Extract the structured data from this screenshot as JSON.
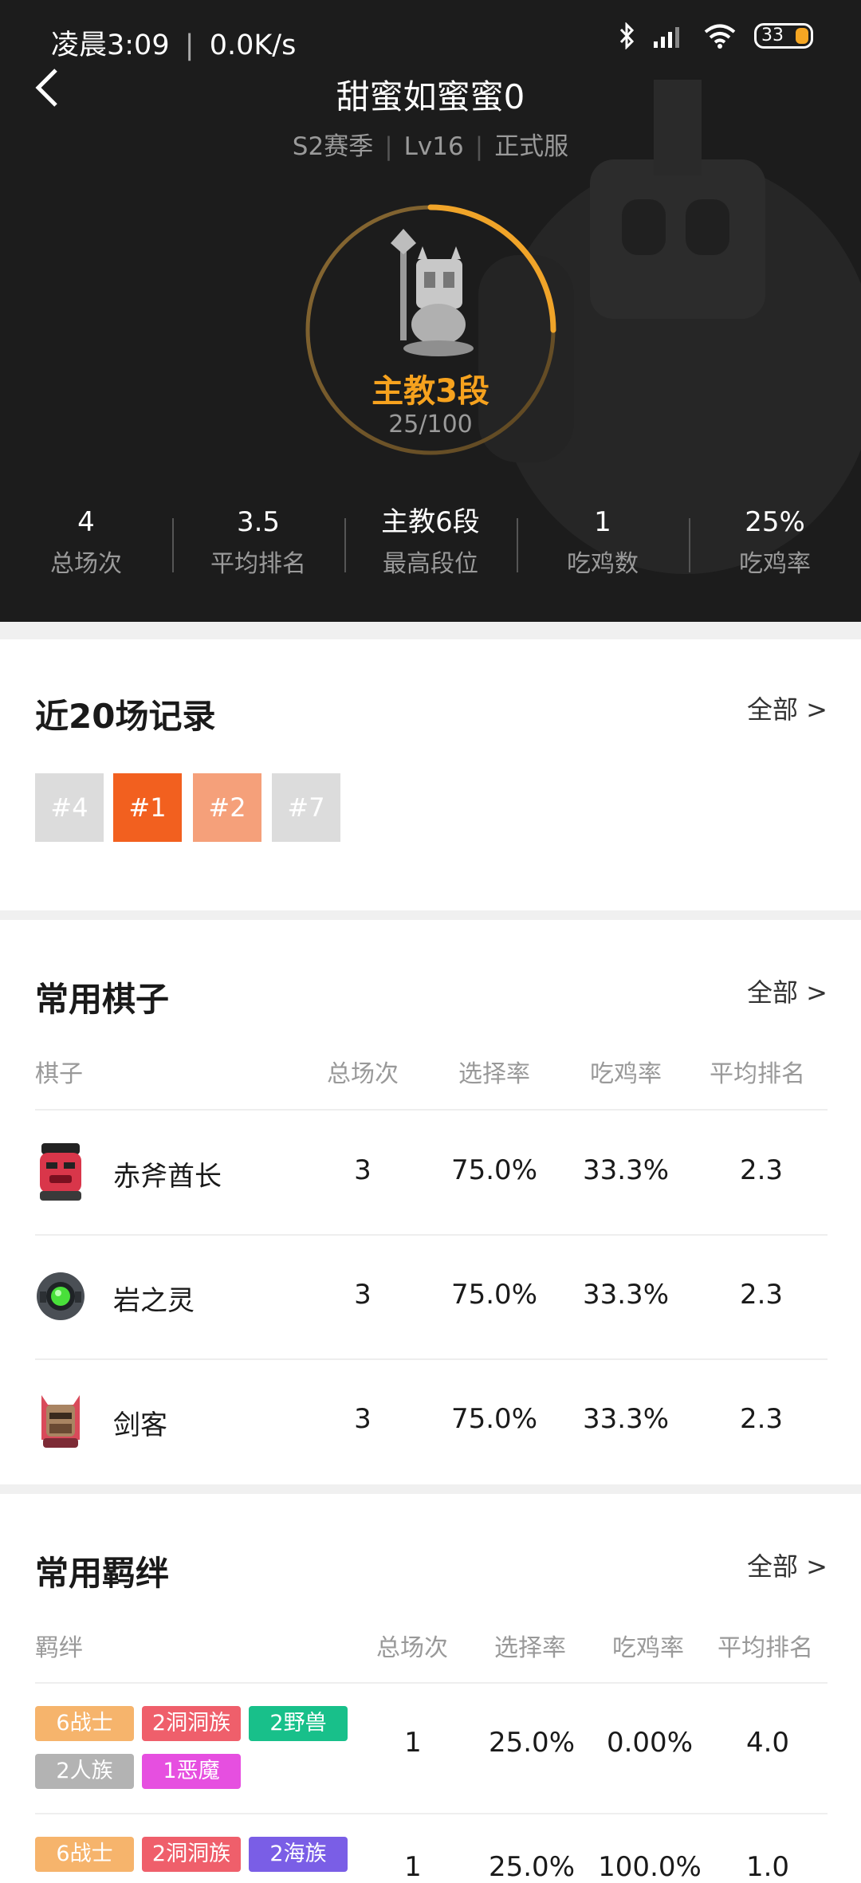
{
  "status_bar": {
    "time": "凌晨3:09",
    "speed": "0.0K/s",
    "battery": "33"
  },
  "header": {
    "title": "甜蜜如蜜蜜0",
    "season": "S2赛季",
    "level": "Lv16",
    "server": "正式服"
  },
  "rank": {
    "name": "主教3段",
    "progress_text": "25/100",
    "progress": 0.25
  },
  "stats": [
    {
      "value": "4",
      "label": "总场次"
    },
    {
      "value": "3.5",
      "label": "平均排名"
    },
    {
      "value": "主教6段",
      "label": "最高段位"
    },
    {
      "value": "1",
      "label": "吃鸡数"
    },
    {
      "value": "25%",
      "label": "吃鸡率"
    }
  ],
  "recent": {
    "title": "近20场记录",
    "more": "全部 >",
    "ranks": [
      {
        "label": "#4",
        "color": "#dcdcdc"
      },
      {
        "label": "#1",
        "color": "#f2601f"
      },
      {
        "label": "#2",
        "color": "#f5a07a"
      },
      {
        "label": "#7",
        "color": "#dcdcdc"
      }
    ]
  },
  "pieces": {
    "title": "常用棋子",
    "more": "全部 >",
    "headers": [
      "棋子",
      "总场次",
      "选择率",
      "吃鸡率",
      "平均排名"
    ],
    "rows": [
      {
        "name": "赤斧酋长",
        "icon": "red-chief-icon",
        "games": "3",
        "pick": "75.0%",
        "win": "33.3%",
        "avg": "2.3"
      },
      {
        "name": "岩之灵",
        "icon": "rock-spirit-icon",
        "games": "3",
        "pick": "75.0%",
        "win": "33.3%",
        "avg": "2.3"
      },
      {
        "name": "剑客",
        "icon": "swordsman-icon",
        "games": "3",
        "pick": "75.0%",
        "win": "33.3%",
        "avg": "2.3"
      }
    ]
  },
  "bonds": {
    "title": "常用羁绊",
    "more": "全部 >",
    "headers": [
      "羁绊",
      "总场次",
      "选择率",
      "吃鸡率",
      "平均排名"
    ],
    "rows": [
      {
        "tags": [
          {
            "label": "6战士",
            "color": "#f6b46c"
          },
          {
            "label": "2洞洞族",
            "color": "#ef5f6b"
          },
          {
            "label": "2野兽",
            "color": "#18c08a"
          },
          {
            "label": "2人族",
            "color": "#b3b3b3"
          },
          {
            "label": "1恶魔",
            "color": "#e64fe0"
          }
        ],
        "games": "1",
        "pick": "25.0%",
        "win": "0.00%",
        "avg": "4.0"
      },
      {
        "tags": [
          {
            "label": "6战士",
            "color": "#f6b46c"
          },
          {
            "label": "2洞洞族",
            "color": "#ef5f6b"
          },
          {
            "label": "2海族",
            "color": "#7a5ee6"
          }
        ],
        "games": "1",
        "pick": "25.0%",
        "win": "100.0%",
        "avg": "1.0"
      }
    ]
  }
}
